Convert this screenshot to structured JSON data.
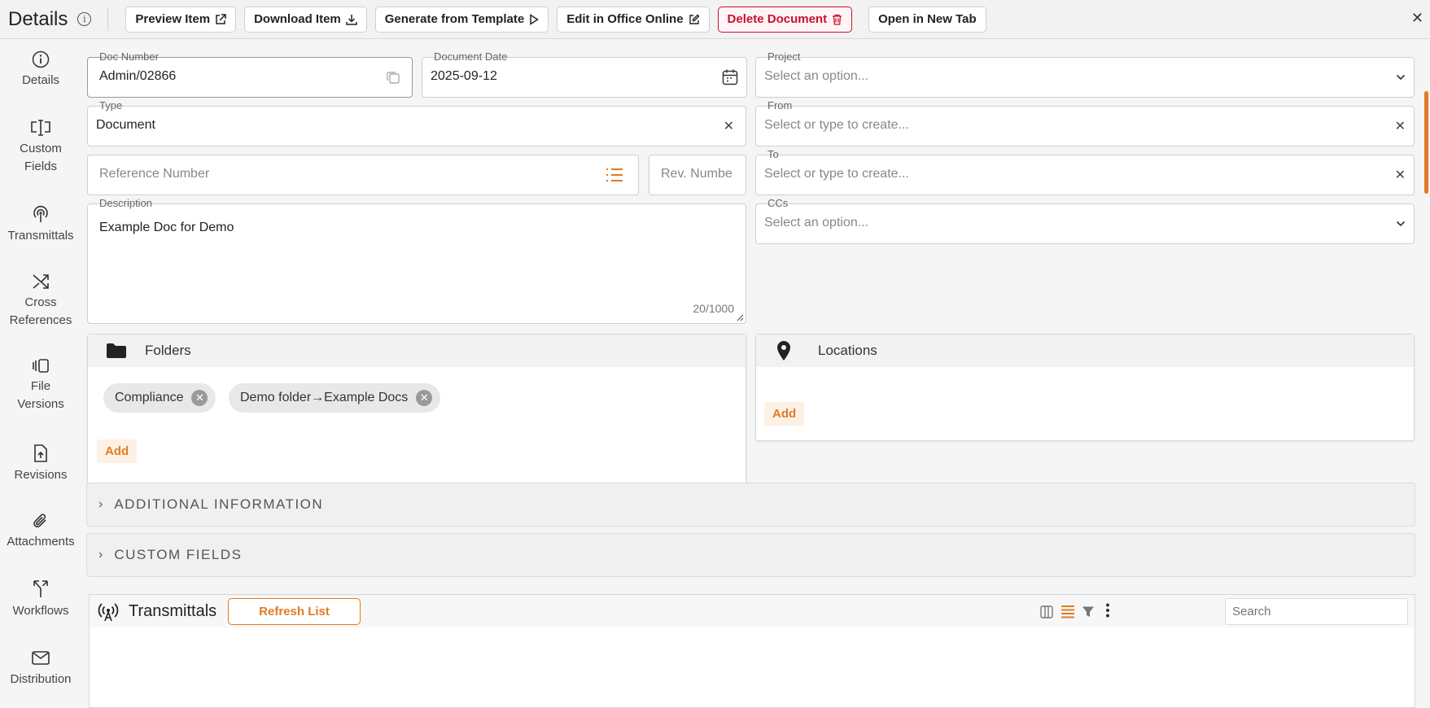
{
  "header": {
    "title": "Details",
    "buttons": {
      "preview": "Preview Item",
      "download": "Download Item",
      "generate": "Generate from Template",
      "edit_office": "Edit in Office Online",
      "delete": "Delete Document",
      "open_new_tab": "Open in New Tab"
    }
  },
  "sidebar": {
    "items": [
      {
        "line1": "Details",
        "line2": "",
        "icon": "info-icon"
      },
      {
        "line1": "Custom",
        "line2": "Fields",
        "icon": "text-cursor-icon"
      },
      {
        "line1": "Transmittals",
        "line2": "",
        "icon": "broadcast-icon"
      },
      {
        "line1": "Cross",
        "line2": "References",
        "icon": "shuffle-icon"
      },
      {
        "line1": "File",
        "line2": "Versions",
        "icon": "layers-icon"
      },
      {
        "line1": "Revisions",
        "line2": "",
        "icon": "file-upload-icon"
      },
      {
        "line1": "Attachments",
        "line2": "",
        "icon": "paperclip-icon"
      },
      {
        "line1": "Workflows",
        "line2": "",
        "icon": "branch-icon"
      },
      {
        "line1": "Distribution",
        "line2": "",
        "icon": "mail-icon"
      }
    ]
  },
  "form": {
    "doc_number": {
      "label": "Doc Number",
      "value": "Admin/02866"
    },
    "document_date": {
      "label": "Document Date",
      "value": "2025-09-12"
    },
    "project": {
      "label": "Project",
      "placeholder": "Select an option..."
    },
    "type": {
      "label": "Type",
      "value": "Document"
    },
    "from": {
      "label": "From",
      "placeholder": "Select or type to create..."
    },
    "reference_number": {
      "placeholder": "Reference Number"
    },
    "rev_number": {
      "placeholder": "Rev. Numbe"
    },
    "to": {
      "label": "To",
      "placeholder": "Select or type to create..."
    },
    "description": {
      "label": "Description",
      "value": "Example Doc for Demo",
      "counter": "20/1000"
    },
    "ccs": {
      "label": "CCs",
      "placeholder": "Select an option..."
    }
  },
  "folders": {
    "title": "Folders",
    "chips": [
      "Compliance",
      "Demo folder→Example Docs"
    ],
    "add": "Add"
  },
  "locations": {
    "title": "Locations",
    "add": "Add"
  },
  "accordions": {
    "additional": "ADDITIONAL INFORMATION",
    "custom": "CUSTOM FIELDS"
  },
  "transmittals": {
    "title": "Transmittals",
    "refresh": "Refresh List",
    "search_placeholder": "Search"
  },
  "colors": {
    "accent": "#e07b24",
    "danger": "#c8102e"
  }
}
